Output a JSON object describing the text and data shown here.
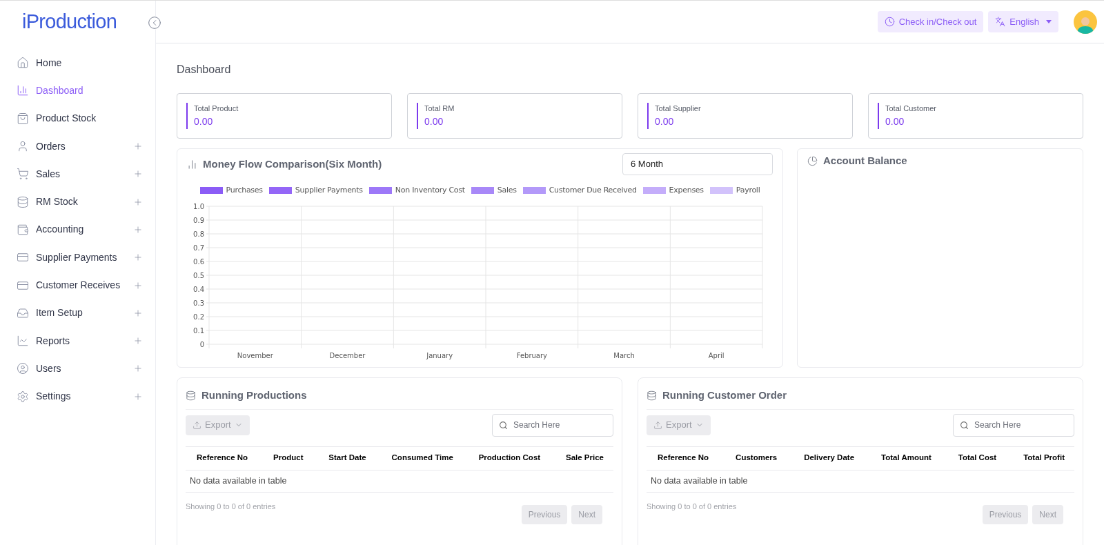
{
  "sidebar": {
    "logo": "iProduction",
    "items": [
      {
        "label": "Home",
        "selected": false,
        "expandable": false
      },
      {
        "label": "Dashboard",
        "selected": true,
        "expandable": false
      },
      {
        "label": "Product Stock",
        "selected": false,
        "expandable": false
      },
      {
        "label": "Orders",
        "selected": false,
        "expandable": true
      },
      {
        "label": "Sales",
        "selected": false,
        "expandable": true
      },
      {
        "label": "RM Stock",
        "selected": false,
        "expandable": true
      },
      {
        "label": "Accounting",
        "selected": false,
        "expandable": true
      },
      {
        "label": "Supplier Payments",
        "selected": false,
        "expandable": true
      },
      {
        "label": "Customer Receives",
        "selected": false,
        "expandable": true
      },
      {
        "label": "Item Setup",
        "selected": false,
        "expandable": true
      },
      {
        "label": "Reports",
        "selected": false,
        "expandable": true
      },
      {
        "label": "Users",
        "selected": false,
        "expandable": true
      },
      {
        "label": "Settings",
        "selected": false,
        "expandable": true
      }
    ]
  },
  "header": {
    "check_button": "Check in/Check out",
    "language": "English"
  },
  "page_title": "Dashboard",
  "stats": [
    {
      "label": "Total Product",
      "value": "0.00"
    },
    {
      "label": "Total RM",
      "value": "0.00"
    },
    {
      "label": "Total Supplier",
      "value": "0.00"
    },
    {
      "label": "Total Customer",
      "value": "0.00"
    }
  ],
  "money_flow": {
    "title": "Money Flow Comparison(Six Month)",
    "period": "6 Month",
    "chart_data": {
      "type": "bar",
      "grid": true,
      "categories": [
        "November",
        "December",
        "January",
        "February",
        "March",
        "April"
      ],
      "ylim": [
        0,
        1
      ],
      "yticks": [
        0,
        0.1,
        0.2,
        0.3,
        0.4,
        0.5,
        0.6,
        0.7,
        0.8,
        0.9,
        {
          "value": 1,
          "label": "1.0"
        }
      ],
      "series": [
        {
          "name": "Purchases",
          "color": "#8b5cf6",
          "values": [
            null,
            null,
            null,
            null,
            null,
            null
          ]
        },
        {
          "name": "Supplier Payments",
          "color": "#9466f7",
          "values": [
            null,
            null,
            null,
            null,
            null,
            null
          ]
        },
        {
          "name": "Non Inventory Cost",
          "color": "#9d78f8",
          "values": [
            null,
            null,
            null,
            null,
            null,
            null
          ]
        },
        {
          "name": "Sales",
          "color": "#a888f8",
          "values": [
            null,
            null,
            null,
            null,
            null,
            null
          ]
        },
        {
          "name": "Customer Due Received",
          "color": "#b399f9",
          "values": [
            null,
            null,
            null,
            null,
            null,
            null
          ]
        },
        {
          "name": "Expenses",
          "color": "#c4adfa",
          "values": [
            null,
            null,
            null,
            null,
            null,
            null
          ]
        },
        {
          "name": "Payroll",
          "color": "#d2c2fb",
          "values": [
            null,
            null,
            null,
            null,
            null,
            null
          ]
        }
      ]
    }
  },
  "account_balance": {
    "title": "Account Balance"
  },
  "tables": [
    {
      "title": "Running Productions",
      "export": "Export",
      "search_placeholder": "Search Here",
      "columns": [
        "Reference No",
        "Product",
        "Start Date",
        "Consumed Time",
        "Production Cost",
        "Sale Price"
      ],
      "empty": "No data available in table",
      "info": "Showing 0 to 0 of 0 entries",
      "previous": "Previous",
      "next": "Next"
    },
    {
      "title": "Running Customer Order",
      "export": "Export",
      "search_placeholder": "Search Here",
      "columns": [
        "Reference No",
        "Customers",
        "Delivery Date",
        "Total Amount",
        "Total Cost",
        "Total Profit"
      ],
      "empty": "No data available in table",
      "info": "Showing 0 to 0 of 0 entries",
      "previous": "Previous",
      "next": "Next"
    }
  ]
}
